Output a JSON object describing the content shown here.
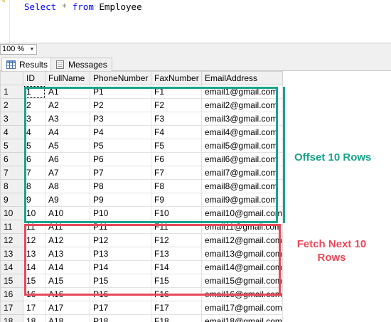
{
  "query": {
    "select_kw": "Select",
    "star": "*",
    "from_kw": "from",
    "table": "Employee"
  },
  "zoom": {
    "value": "100 %"
  },
  "tabs": [
    {
      "label": "Results",
      "icon": "results-grid-icon"
    },
    {
      "label": "Messages",
      "icon": "messages-icon"
    }
  ],
  "columns": [
    "ID",
    "FullName",
    "PhoneNumber",
    "FaxNumber",
    "EmailAddress"
  ],
  "rows": [
    [
      "1",
      "1",
      "A1",
      "P1",
      "F1",
      "email1@gmail.com"
    ],
    [
      "2",
      "2",
      "A2",
      "P2",
      "F2",
      "email2@gmail.com"
    ],
    [
      "3",
      "3",
      "A3",
      "P3",
      "F3",
      "email3@gmail.com"
    ],
    [
      "4",
      "4",
      "A4",
      "P4",
      "F4",
      "email4@gmail.com"
    ],
    [
      "5",
      "5",
      "A5",
      "P5",
      "F5",
      "email5@gmail.com"
    ],
    [
      "6",
      "6",
      "A6",
      "P6",
      "F6",
      "email6@gmail.com"
    ],
    [
      "7",
      "7",
      "A7",
      "P7",
      "F7",
      "email7@gmail.com"
    ],
    [
      "8",
      "8",
      "A8",
      "P8",
      "F8",
      "email8@gmail.com"
    ],
    [
      "9",
      "9",
      "A9",
      "P9",
      "F9",
      "email9@gmail.com"
    ],
    [
      "10",
      "10",
      "A10",
      "P10",
      "F10",
      "email10@gmail.com"
    ],
    [
      "11",
      "11",
      "A11",
      "P11",
      "F11",
      "email11@gmail.com"
    ],
    [
      "12",
      "12",
      "A12",
      "P12",
      "F12",
      "email12@gmail.com"
    ],
    [
      "13",
      "13",
      "A13",
      "P13",
      "F13",
      "email13@gmail.com"
    ],
    [
      "14",
      "14",
      "A14",
      "P14",
      "F14",
      "email14@gmail.com"
    ],
    [
      "15",
      "15",
      "A15",
      "P15",
      "F15",
      "email15@gmail.com"
    ],
    [
      "16",
      "16",
      "A16",
      "P16",
      "F16",
      "email16@gmail.com"
    ],
    [
      "17",
      "17",
      "A17",
      "P17",
      "F17",
      "email17@gmail.com"
    ],
    [
      "18",
      "18",
      "A18",
      "P18",
      "F18",
      "email18@gmail.com"
    ]
  ],
  "annotations": {
    "offset_label": "Offset 10 Rows",
    "fetch_label_line1": "Fetch Next 10",
    "fetch_label_line2": "Rows",
    "offset_color": "#1aa38b",
    "fetch_color": "#e8495a"
  }
}
